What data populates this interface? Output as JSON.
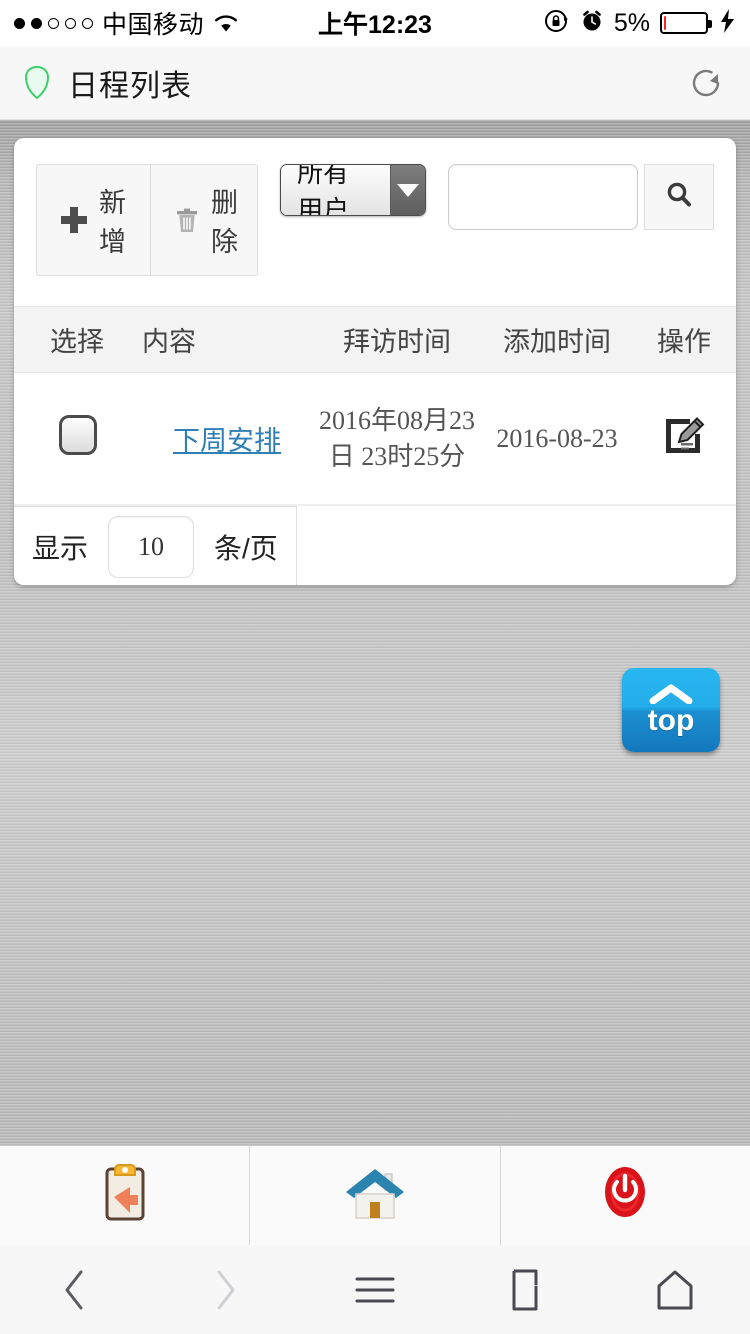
{
  "status_bar": {
    "signal_dots_filled": 2,
    "signal_dots_total": 5,
    "carrier": "中国移动",
    "wifi_icon": "wifi-icon",
    "time": "上午12:23",
    "rotation_lock_icon": "rotation-lock-icon",
    "alarm_icon": "alarm-icon",
    "battery_percent": "5%",
    "battery_level": 5,
    "charging_icon": "charging-bolt-icon"
  },
  "browser_header": {
    "security_icon": "green-shield-icon",
    "title": "日程列表",
    "refresh_icon": "refresh-icon"
  },
  "toolbar": {
    "add_label": "新增",
    "add_icon": "plus-icon",
    "delete_label": "删除",
    "delete_icon": "trash-icon",
    "user_filter_value": "所有用户",
    "dropdown_icon": "chevron-down-icon",
    "search_value": "",
    "search_placeholder": "",
    "search_icon": "search-icon"
  },
  "table": {
    "headers": {
      "select": "选择",
      "content": "内容",
      "visit_time": "拜访时间",
      "add_time": "添加时间",
      "action": "操作"
    },
    "rows": [
      {
        "checked": false,
        "content": "下周安排",
        "visit_time": "2016年08月23日 23时25分",
        "add_time": "2016-08-23",
        "action_icon": "edit-pencil-icon"
      }
    ]
  },
  "pager": {
    "prefix": "显示",
    "page_size": "10",
    "suffix": "条/页"
  },
  "back_to_top": {
    "label": "top",
    "icon": "chevron-up-icon"
  },
  "app_tabs": [
    {
      "name": "records",
      "icon": "clipboard-back-icon"
    },
    {
      "name": "home",
      "icon": "house-icon"
    },
    {
      "name": "logout",
      "icon": "power-icon"
    }
  ],
  "browser_nav": [
    {
      "name": "back",
      "icon": "chevron-left-icon",
      "enabled": true
    },
    {
      "name": "forward",
      "icon": "chevron-right-icon",
      "enabled": false
    },
    {
      "name": "menu",
      "icon": "hamburger-icon",
      "enabled": true
    },
    {
      "name": "tabs",
      "icon": "tabs-page-icon",
      "enabled": true
    },
    {
      "name": "home",
      "icon": "home-pentagon-icon",
      "enabled": true
    }
  ],
  "colors": {
    "link": "#3080b8",
    "shield": "#3ecf6a",
    "top_button": "#23ade9",
    "battery_low": "#f22222"
  }
}
